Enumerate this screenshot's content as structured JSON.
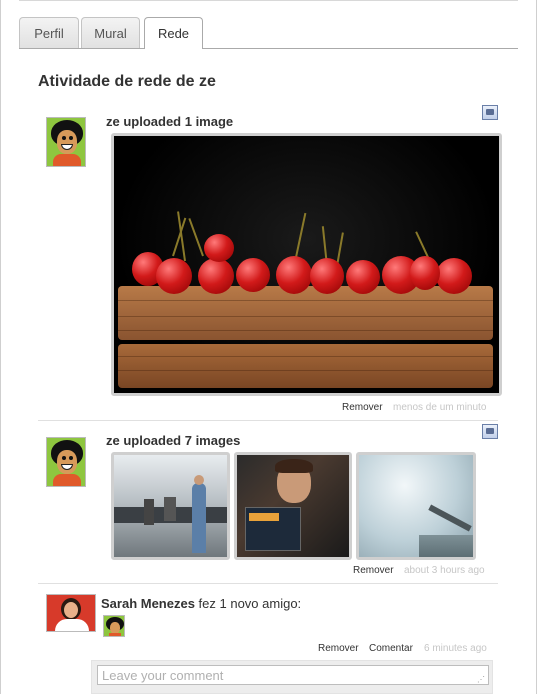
{
  "tabs": [
    {
      "label": "Perfil",
      "active": false
    },
    {
      "label": "Mural",
      "active": false
    },
    {
      "label": "Rede",
      "active": true
    }
  ],
  "heading": "Atividade de rede de ze",
  "activities": [
    {
      "title": "ze uploaded 1 image",
      "type_icon": "image-icon",
      "images": [
        "cherries on wooden board"
      ],
      "actions": [
        "Remover"
      ],
      "time": "menos de um minuto"
    },
    {
      "title": "ze uploaded 7 images",
      "type_icon": "image-icon",
      "images": [
        "office presentation",
        "boy with linux magazine",
        "foggy pier"
      ],
      "actions": [
        "Remover"
      ],
      "time": "about 3 hours ago"
    },
    {
      "user": "Sarah Menezes",
      "text": " fez 1 novo amigo:",
      "actions": [
        "Remover",
        "Comentar"
      ],
      "time": "6 minutes ago"
    }
  ],
  "comment": {
    "placeholder": "Leave your comment",
    "value": ""
  },
  "colors": {
    "tab_border": "#aaaaaa",
    "time_text": "#c6c6c6",
    "avatar_green": "#8ec63f",
    "avatar_red": "#d73a2a"
  }
}
